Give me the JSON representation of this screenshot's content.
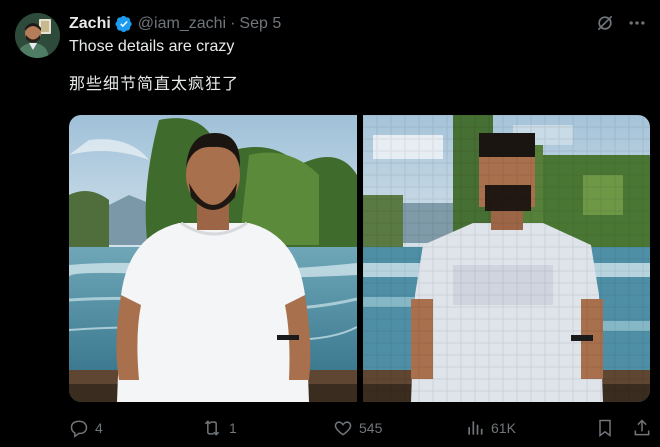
{
  "author": {
    "display_name": "Zachi",
    "handle": "@iam_zachi",
    "separator": "·",
    "date": "Sep 5",
    "verified_color": "#1d9bf0"
  },
  "post": {
    "text_en": "Those details are crazy",
    "text_zh": "那些细节简直太疯狂了"
  },
  "header_actions": {
    "grok_icon": "grok-icon",
    "more_icon": "more-icon"
  },
  "media": {
    "left_image": "photo-man-white-tshirt-river",
    "right_image": "photo-man-white-tshirt-river-pixelated"
  },
  "actions": {
    "replies": "4",
    "reposts": "1",
    "likes": "545",
    "views": "61K"
  },
  "colors": {
    "background": "#000000",
    "text": "#e7e9ea",
    "muted": "#71767b",
    "accent": "#1d9bf0"
  }
}
